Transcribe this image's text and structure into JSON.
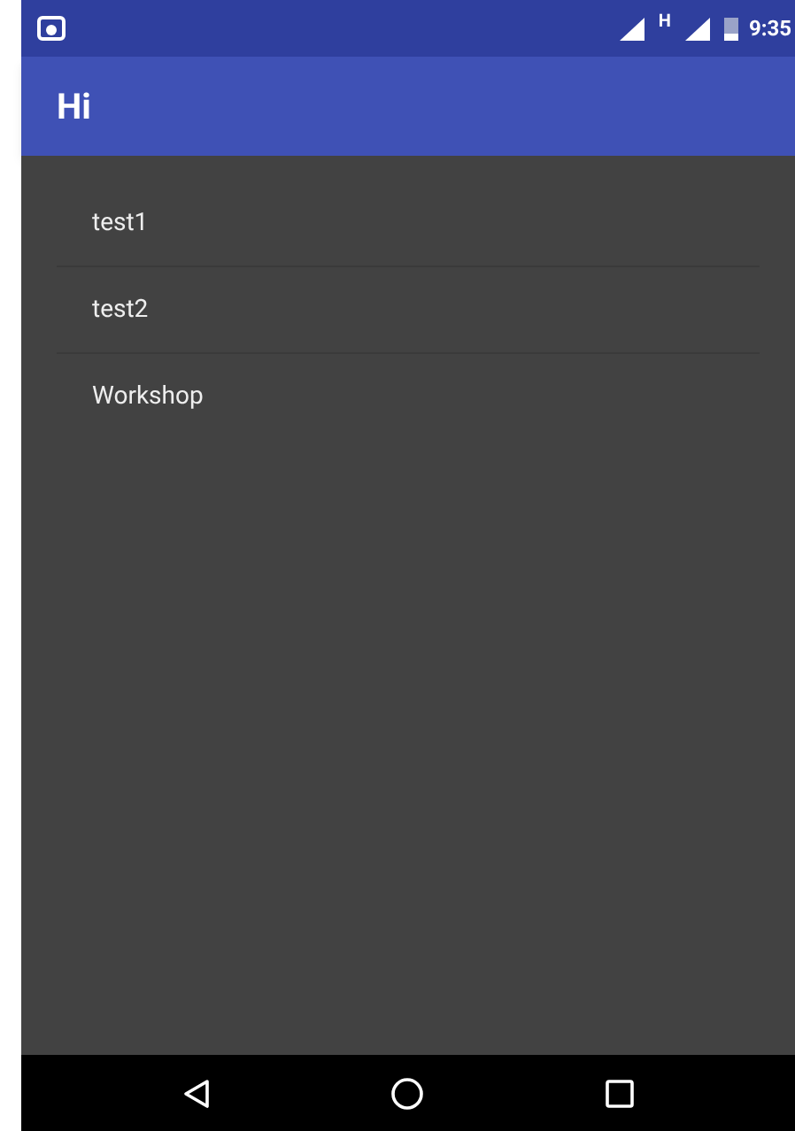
{
  "status_bar": {
    "network": "H",
    "time": "9:35"
  },
  "app_bar": {
    "title": "Hi"
  },
  "list": {
    "items": [
      {
        "label": "test1"
      },
      {
        "label": "test2"
      },
      {
        "label": "Workshop"
      }
    ]
  }
}
